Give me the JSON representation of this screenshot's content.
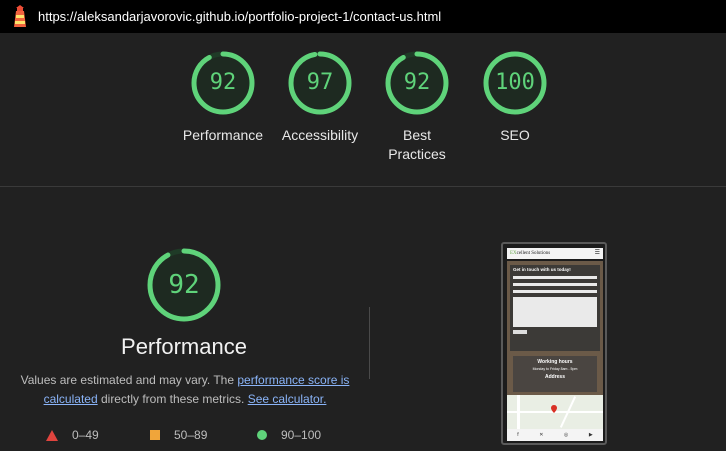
{
  "topbar": {
    "url": "https://aleksandarjavorovic.github.io/portfolio-project-1/contact-us.html",
    "icon": "lighthouse-icon"
  },
  "colors": {
    "pass": "#5fd37a",
    "average": "#f0a53a",
    "fail": "#e0443e",
    "track": "#1f3b27"
  },
  "scores": [
    {
      "value": "92",
      "label": "Performance",
      "fraction": 0.92
    },
    {
      "value": "97",
      "label": "Accessibility",
      "fraction": 0.97
    },
    {
      "value": "92",
      "label": "Best Practices",
      "fraction": 0.92
    },
    {
      "value": "100",
      "label": "SEO",
      "fraction": 1.0
    }
  ],
  "detail": {
    "score": "92",
    "fraction": 0.92,
    "title": "Performance",
    "desc_1": "Values are estimated and may vary. The ",
    "link_1": "performance score is calculated",
    "desc_2": " directly from these metrics. ",
    "link_2": "See calculator."
  },
  "legend": [
    {
      "icon": "fail-triangle-icon",
      "range": "0–49"
    },
    {
      "icon": "average-square-icon",
      "range": "50–89"
    },
    {
      "icon": "pass-circle-icon",
      "range": "90–100"
    }
  ],
  "preview": {
    "brand_prefix": "EX",
    "brand_name": "cellent Solutions",
    "form_title": "Get in touch with us today!",
    "hours_title": "Working hours",
    "hours_text": "Monday to Friday 8am - 5pm",
    "address_title": "Address"
  }
}
